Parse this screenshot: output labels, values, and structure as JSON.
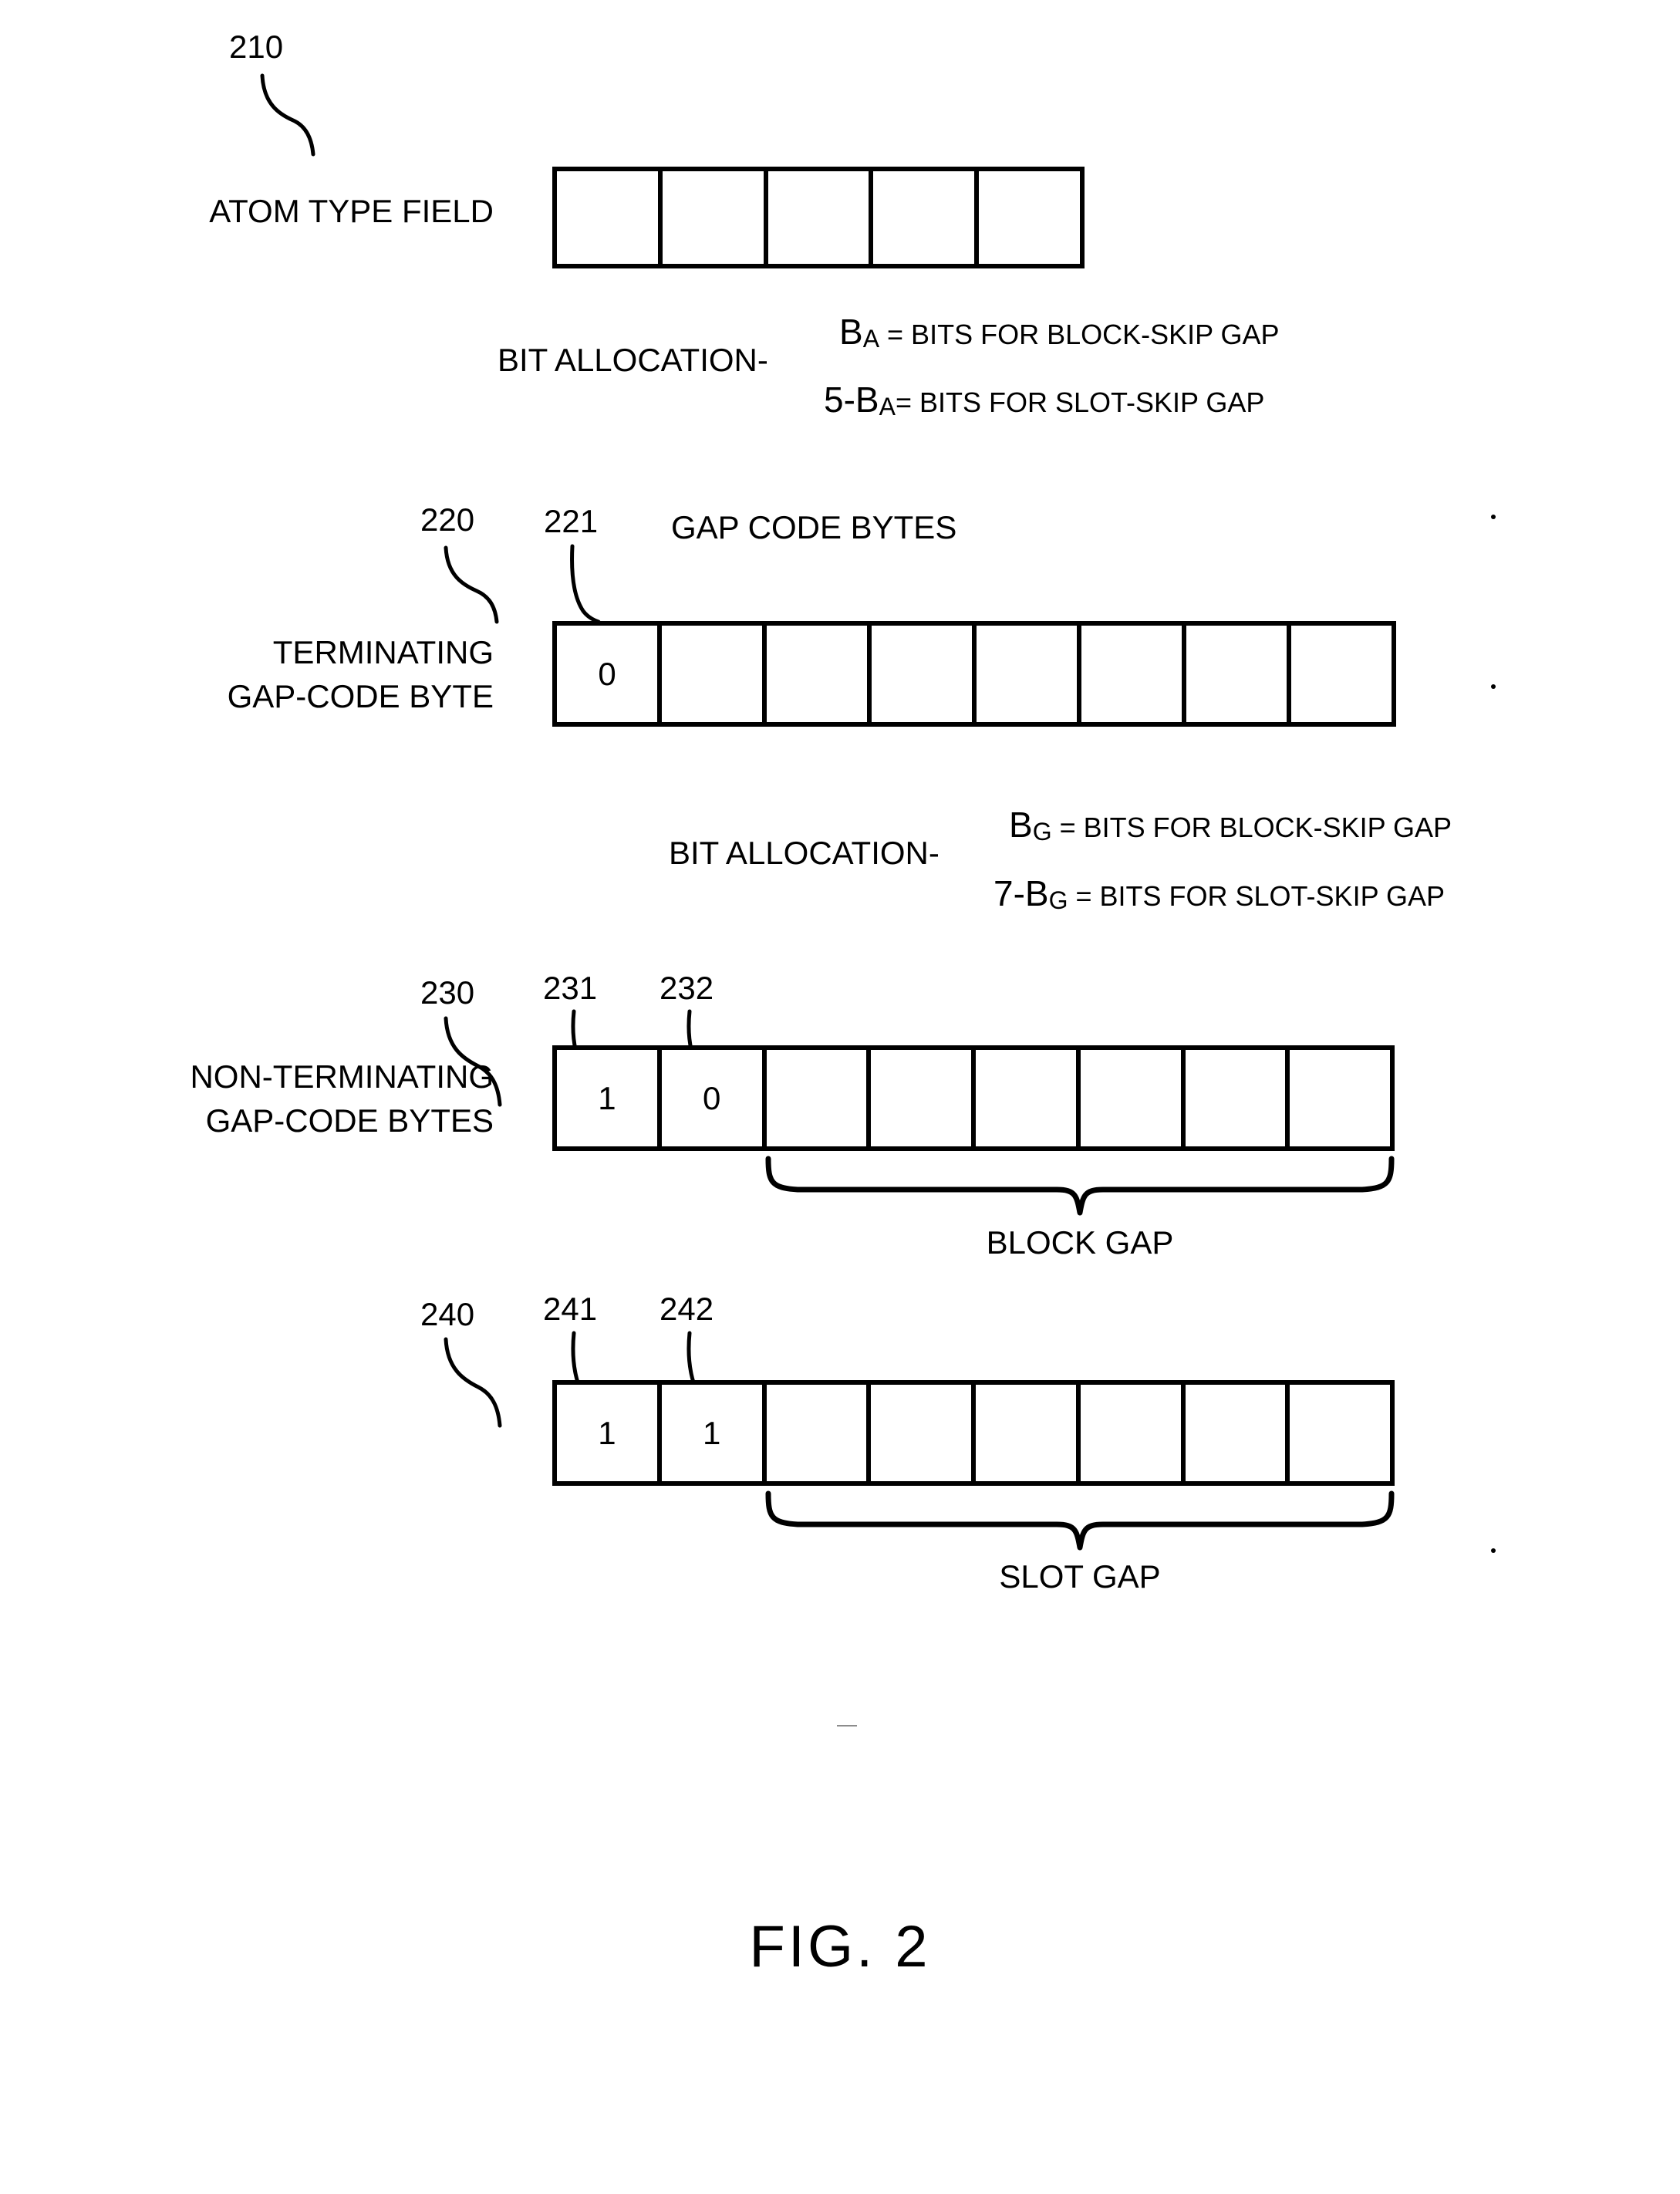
{
  "figure": {
    "caption": "FIG. 2"
  },
  "rows": [
    {
      "ref": "210",
      "label_lines": [
        "ATOM TYPE FIELD"
      ],
      "cells": [
        "",
        "",
        "",
        "",
        ""
      ],
      "cell_count": 5
    },
    {
      "ref": "220",
      "sub_ref": "221",
      "header": "GAP CODE BYTES",
      "label_lines": [
        "TERMINATING",
        "GAP-CODE BYTE"
      ],
      "cells": [
        "0",
        "",
        "",
        "",
        "",
        "",
        "",
        ""
      ],
      "cell_count": 8
    },
    {
      "ref": "230",
      "sub_refs": [
        "231",
        "232"
      ],
      "label_lines": [
        "NON-TERMINATING",
        "GAP-CODE BYTES"
      ],
      "cells": [
        "1",
        "0",
        "",
        "",
        "",
        "",
        "",
        ""
      ],
      "cell_count": 8,
      "brace_label": "BLOCK GAP"
    },
    {
      "ref": "240",
      "sub_refs": [
        "241",
        "242"
      ],
      "label_lines": [],
      "cells": [
        "1",
        "1",
        "",
        "",
        "",
        "",
        "",
        ""
      ],
      "cell_count": 8,
      "brace_label": "SLOT GAP"
    }
  ],
  "bit_allocation_1": {
    "title": "BIT ALLOCATION-",
    "line1_var": "B",
    "line1_sub": "A",
    "line1_text": " = BITS FOR BLOCK-SKIP GAP",
    "line2_prefix": "5-B",
    "line2_sub": "A",
    "line2_text": "= BITS FOR SLOT-SKIP GAP"
  },
  "bit_allocation_2": {
    "title": "BIT ALLOCATION-",
    "line1_var": "B",
    "line1_sub": "G",
    "line1_text": " = BITS FOR BLOCK-SKIP GAP",
    "line2_prefix": "7-B",
    "line2_sub": "G",
    "line2_text": " = BITS FOR SLOT-SKIP GAP"
  }
}
